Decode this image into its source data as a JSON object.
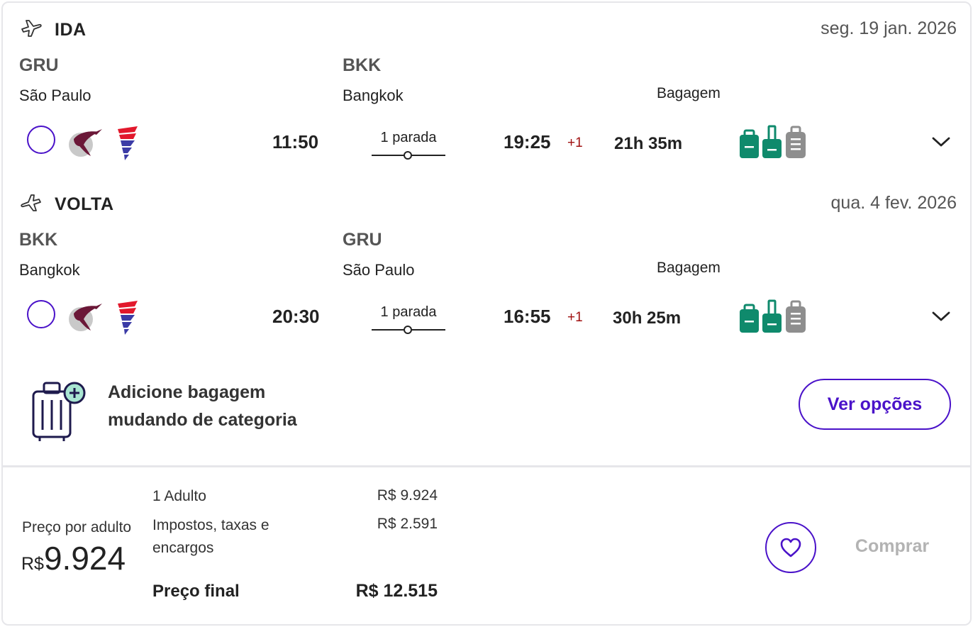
{
  "legs": [
    {
      "label": "IDA",
      "icon": "plane-depart-icon",
      "date": "seg. 19 jan. 2026",
      "origin_code": "GRU",
      "origin_city": "São Paulo",
      "dest_code": "BKK",
      "dest_city": "Bangkok",
      "baggage_label": "Bagagem",
      "depart_time": "11:50",
      "stops": "1 parada",
      "arrive_time": "19:25",
      "day_offset": "+1",
      "duration": "21h 35m"
    },
    {
      "label": "VOLTA",
      "icon": "plane-return-icon",
      "date": "qua. 4 fev. 2026",
      "origin_code": "BKK",
      "origin_city": "Bangkok",
      "dest_code": "GRU",
      "dest_city": "São Paulo",
      "baggage_label": "Bagagem",
      "depart_time": "20:30",
      "stops": "1 parada",
      "arrive_time": "16:55",
      "day_offset": "+1",
      "duration": "30h 25m"
    }
  ],
  "promo": {
    "line1": "Adicione bagagem",
    "line2": "mudando de categoria",
    "button": "Ver opções"
  },
  "pricing": {
    "per_adult_label": "Preço por adulto",
    "currency": "R$",
    "per_adult_amount": "9.924",
    "adult_label": "1 Adulto",
    "adult_value": "R$ 9.924",
    "taxes_label_1": "Impostos, taxas e",
    "taxes_label_2": "encargos",
    "taxes_value": "R$ 2.591",
    "final_label": "Preço final",
    "final_value": "R$ 12.515"
  },
  "actions": {
    "buy_label": "Comprar"
  },
  "colors": {
    "accent": "#4a12c9",
    "baggage_included": "#0f8a6c",
    "baggage_excluded": "#8e8e8e",
    "day_offset": "#a01010"
  }
}
